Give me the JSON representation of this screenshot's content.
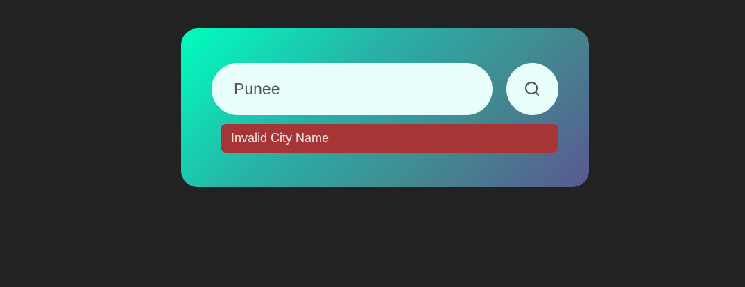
{
  "search": {
    "value": "Punee",
    "icon": "search-icon"
  },
  "error": {
    "message": "Invalid City Name"
  },
  "colors": {
    "background": "#222222",
    "gradient_start": "#00ffbf",
    "gradient_end": "#5a5891",
    "field_fill": "#e9fffb",
    "error_fill": "#a83535"
  }
}
